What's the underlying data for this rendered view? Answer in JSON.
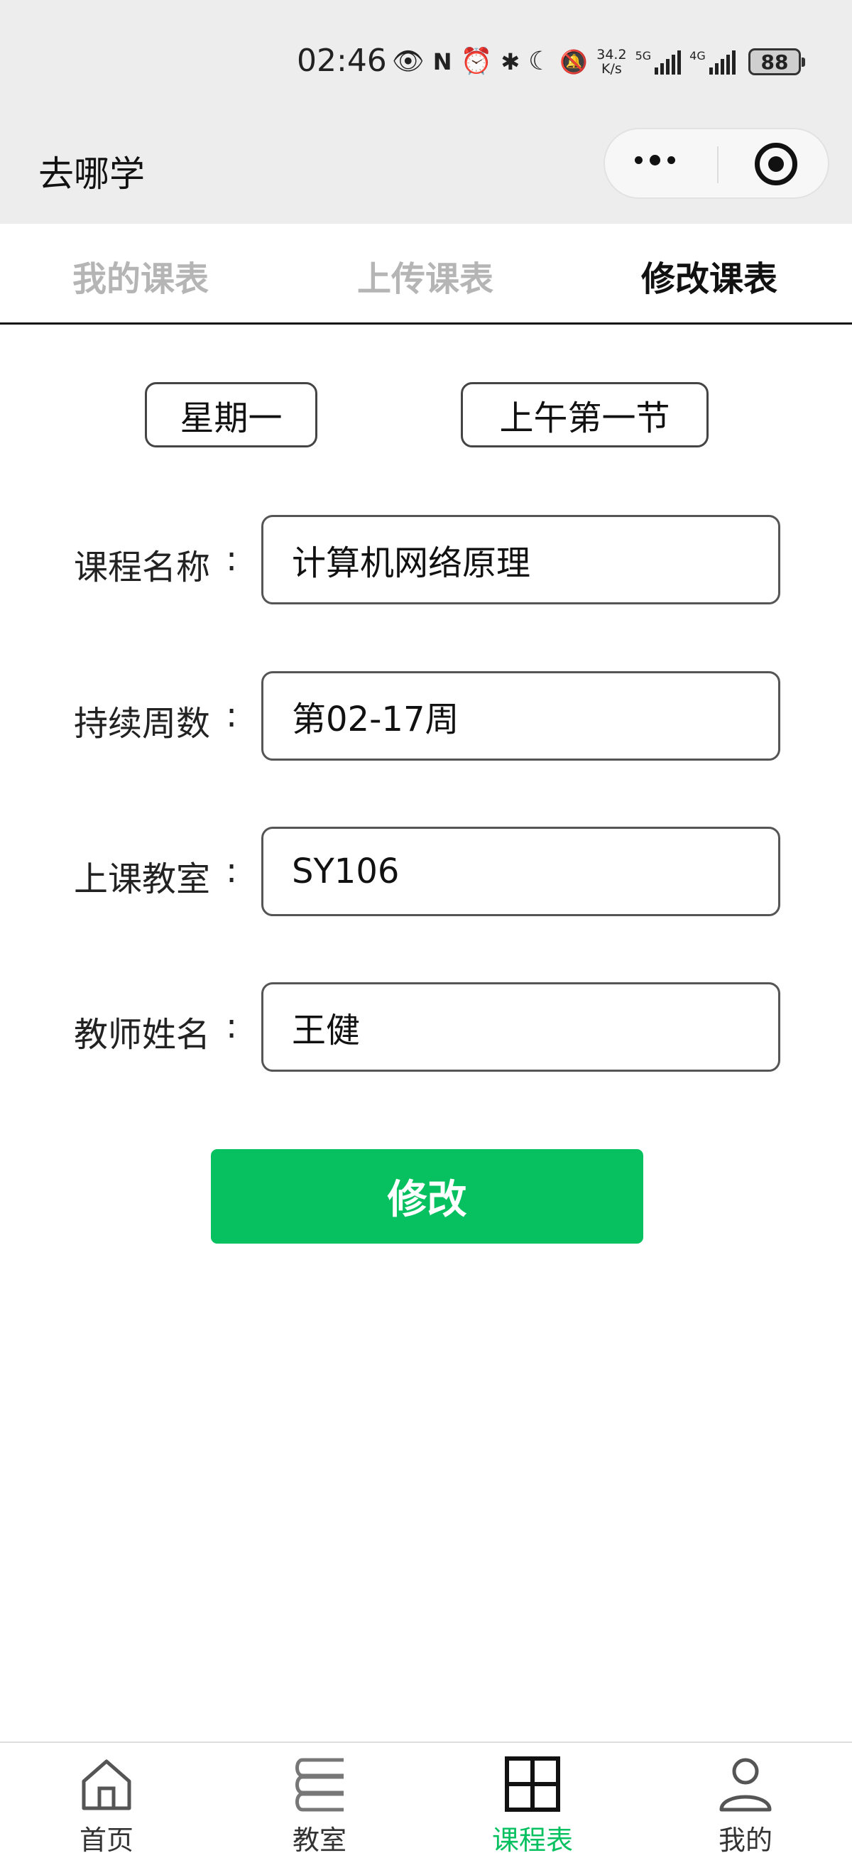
{
  "status_bar": {
    "time": "02:46",
    "net_speed_value": "34.2",
    "net_speed_unit": "K/s",
    "sim1_label": "5G",
    "sim2_label": "4G",
    "battery": "88",
    "icons": [
      "eye-icon",
      "nfc-icon",
      "alarm-icon",
      "bluetooth-icon",
      "moon-icon",
      "mute-bell-icon",
      "signal-icon",
      "battery-icon"
    ]
  },
  "nav": {
    "title": "去哪学",
    "icons": [
      "more-dots-icon",
      "target-icon"
    ]
  },
  "tabs": [
    {
      "label": "我的课表",
      "active": false
    },
    {
      "label": "上传课表",
      "active": false
    },
    {
      "label": "修改课表",
      "active": true
    }
  ],
  "selectors": {
    "day": "星期一",
    "period": "上午第一节"
  },
  "form": {
    "colon": ":",
    "course_name": {
      "label": "课程名称",
      "value": "计算机网络原理"
    },
    "weeks": {
      "label": "持续周数",
      "value": "第02-17周"
    },
    "classroom": {
      "label": "上课教室",
      "value": "SY106"
    },
    "teacher": {
      "label": "教师姓名",
      "value": "王健"
    }
  },
  "submit_label": "修改",
  "colors": {
    "accent_green": "#07c160",
    "bar_gray": "#ededed",
    "tab_inactive": "#b5b5b5"
  },
  "tabbar": [
    {
      "label": "首页",
      "icon": "home-icon",
      "active": false
    },
    {
      "label": "教室",
      "icon": "books-icon",
      "active": false
    },
    {
      "label": "课程表",
      "icon": "grid-icon",
      "active": true
    },
    {
      "label": "我的",
      "icon": "user-icon",
      "active": false
    }
  ]
}
